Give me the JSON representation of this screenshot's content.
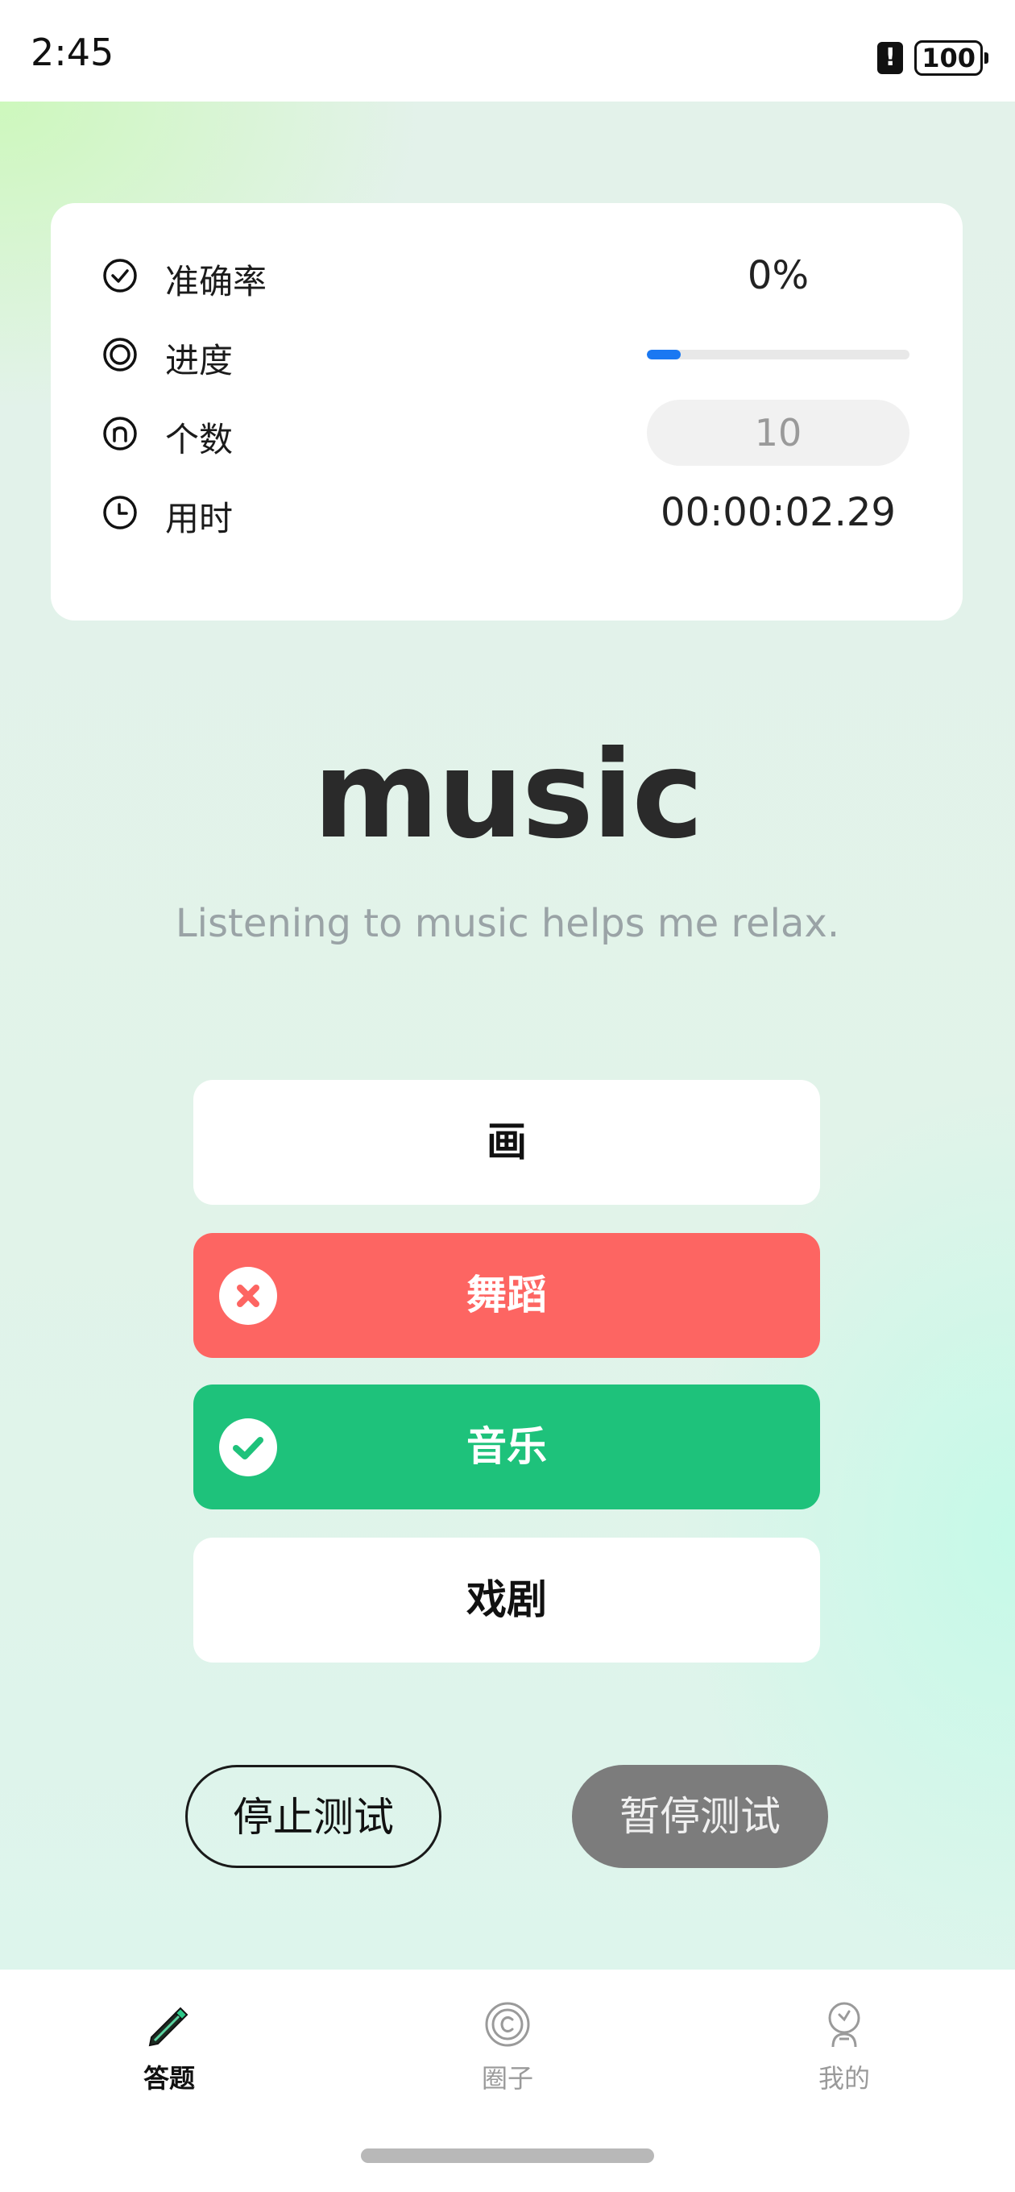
{
  "status_bar": {
    "time": "2:45",
    "battery": "100"
  },
  "stats": {
    "accuracy_label": "准确率",
    "accuracy_value": "0%",
    "progress_label": "进度",
    "progress_fraction": 0.13,
    "count_label": "个数",
    "count_value": "10",
    "time_label": "用时",
    "time_value": "00:00:02.29"
  },
  "question": {
    "word": "music",
    "sentence": "Listening to music helps me relax."
  },
  "options": [
    {
      "label": "画",
      "state": "neutral"
    },
    {
      "label": "舞蹈",
      "state": "wrong"
    },
    {
      "label": "音乐",
      "state": "correct"
    },
    {
      "label": "戏剧",
      "state": "neutral"
    }
  ],
  "actions": {
    "stop_label": "停止测试",
    "pause_label": "暂停测试"
  },
  "tabs": [
    {
      "label": "答题",
      "icon": "pencil-icon",
      "active": true
    },
    {
      "label": "圈子",
      "icon": "circle-c-icon",
      "active": false
    },
    {
      "label": "我的",
      "icon": "person-icon",
      "active": false
    }
  ],
  "colors": {
    "wrong": "#fd6562",
    "correct": "#1ec27b",
    "progress": "#1a78f2",
    "pause_button": "#7c7c7c"
  }
}
